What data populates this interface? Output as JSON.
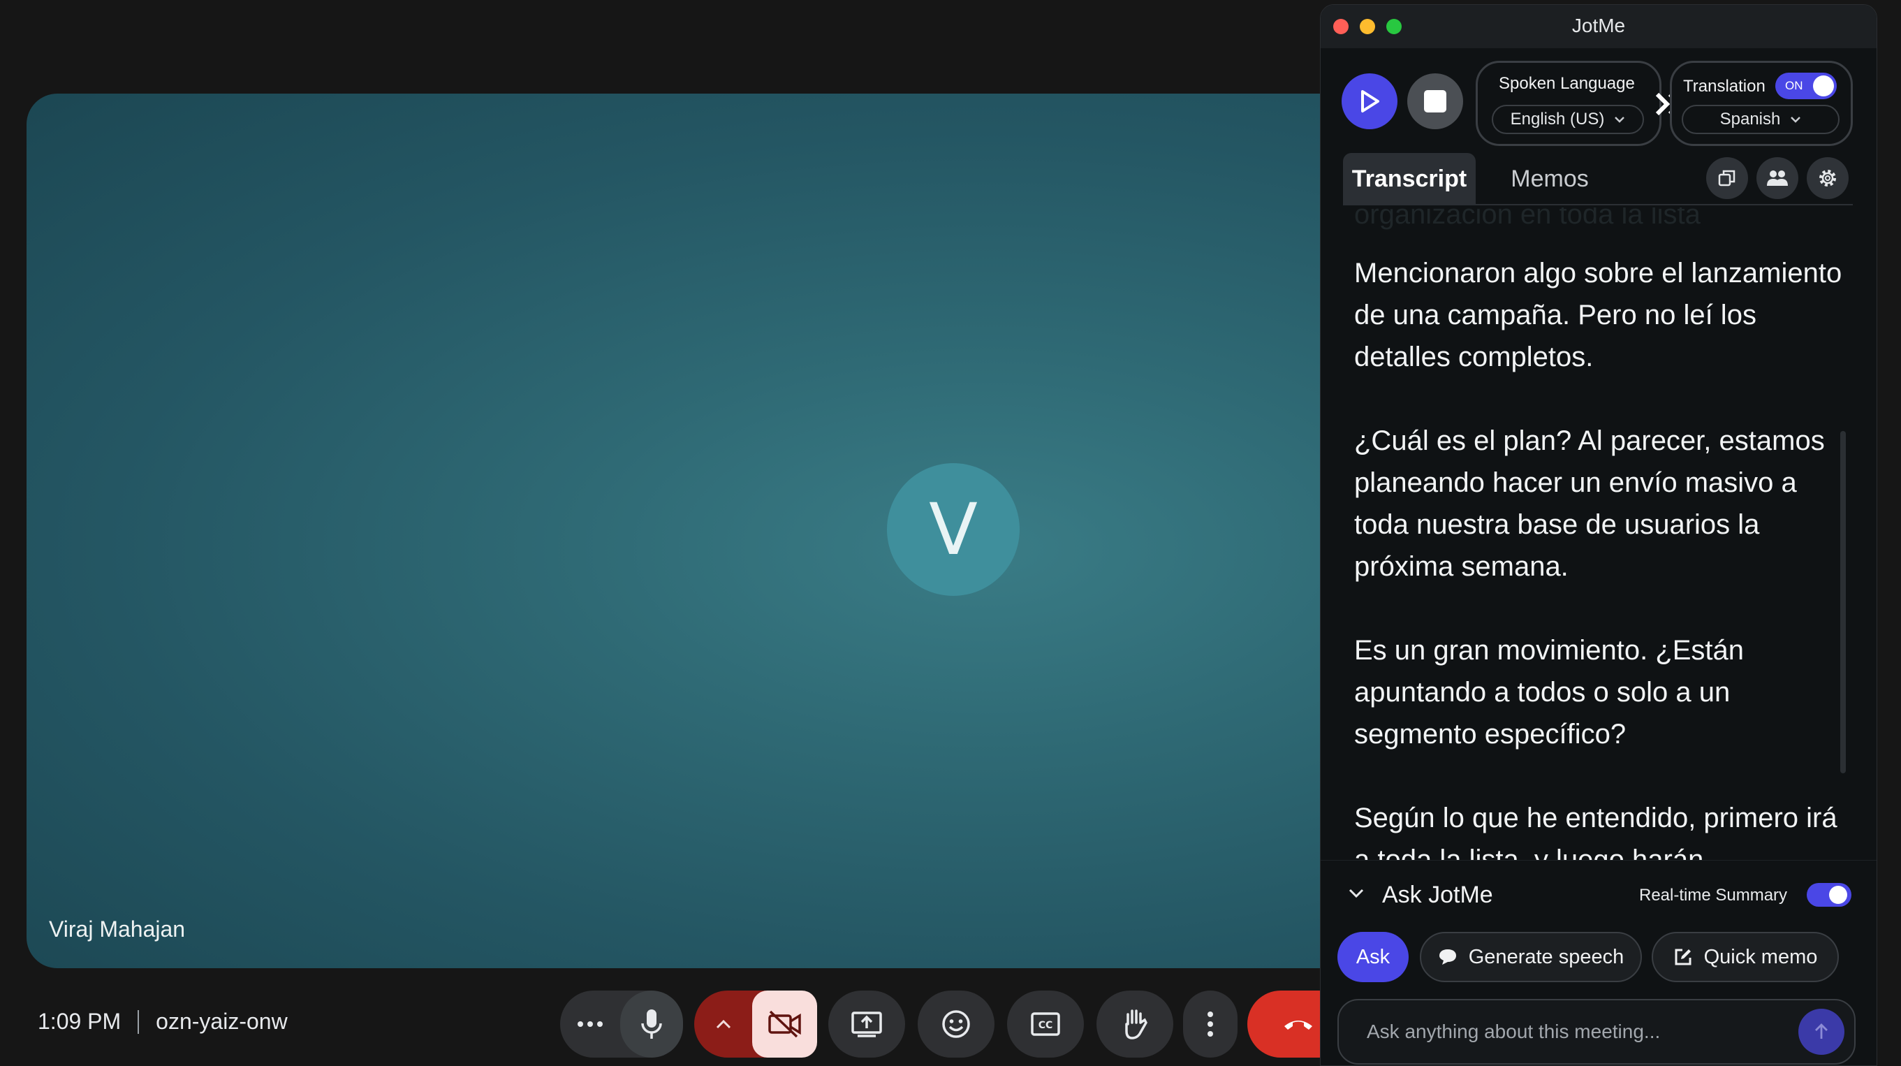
{
  "meeting": {
    "avatar_initial": "V",
    "participant_name": "Viraj Mahajan",
    "time": "1:09 PM",
    "meeting_code": "ozn-yaiz-onw"
  },
  "controls": [
    "more-options",
    "microphone",
    "camera-options",
    "camera-off",
    "present-screen",
    "reactions",
    "captions",
    "raise-hand",
    "more-vert",
    "leave-call"
  ],
  "panel": {
    "app_title": "JotMe",
    "spoken_language": {
      "label": "Spoken Language",
      "value": "English (US)"
    },
    "translation": {
      "label": "Translation",
      "toggle_text": "ON",
      "value": "Spanish",
      "enabled": true
    },
    "tabs": [
      {
        "label": "Transcript",
        "active": true
      },
      {
        "label": "Memos",
        "active": false
      }
    ],
    "transcript": [
      "Mencionaron algo sobre el lanzamiento de una campaña. Pero no leí los detalles completos.",
      "¿Cuál es el plan? Al parecer, estamos planeando hacer un envío masivo a toda nuestra base de usuarios la próxima semana.",
      "Es un gran movimiento. ¿Están apuntando a todos o solo a un segmento específico?",
      "Según lo que he entendido, primero irá a toda la lista, y luego harán"
    ],
    "transcript_ghost": "organización en toda la lista",
    "ask": {
      "title": "Ask JotMe",
      "realtime_summary_label": "Real-time Summary",
      "realtime_summary_on": true,
      "buttons": {
        "ask": "Ask",
        "generate_speech": "Generate speech",
        "quick_memo": "Quick memo"
      },
      "input_placeholder": "Ask anything about this meeting..."
    }
  },
  "colors": {
    "accent": "#4a47e6",
    "stage": "#2f6a75",
    "avatar": "#3f8f9c",
    "leave": "#d93025",
    "camera_off_bg": "#f9dedc",
    "camera_opt_bg": "#8c1d18"
  }
}
